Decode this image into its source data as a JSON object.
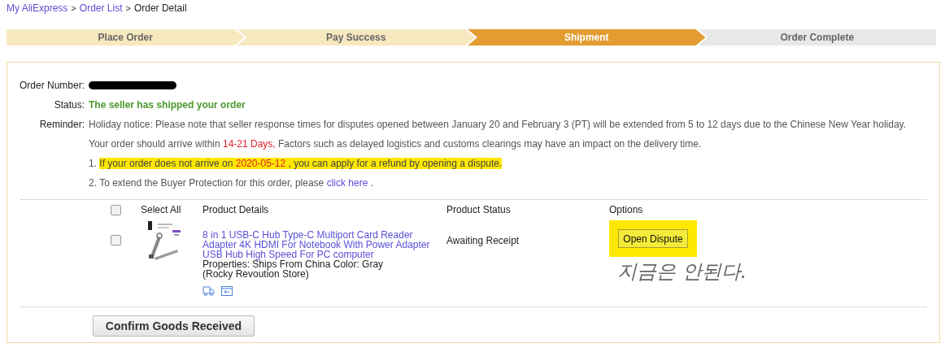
{
  "breadcrumb": [
    {
      "label": "My AliExpress",
      "kind": "link"
    },
    {
      "label": "Order List",
      "kind": "link"
    },
    {
      "label": "Order Detail",
      "kind": "current"
    }
  ],
  "breadcrumb_separator": ">",
  "steps": [
    {
      "label": "Place Order",
      "completed": true,
      "selected": false
    },
    {
      "label": "Pay Success",
      "completed": true,
      "selected": false
    },
    {
      "label": "Shipment",
      "completed": false,
      "selected": true
    },
    {
      "label": "Order Complete",
      "completed": false,
      "selected": false
    }
  ],
  "order": {
    "number_label": "Order Number:",
    "number_redacted": true,
    "status_label": "Status:",
    "status": "The seller has shipped your order",
    "reminder_label": "Reminder:",
    "reminders": [
      {
        "kind": "plain",
        "text": "Holiday notice: Please note that seller response times for disputes opened between January 20 and February 3 (PT) will be extended from 5 to 12 days due to the Chinese New Year holiday."
      },
      {
        "kind": "arrival",
        "before": "Your order should arrive within",
        "days": "14-21 Days,",
        "after": "Factors such as delayed logistics and customs clearings may have an impact on the delivery time."
      },
      {
        "kind": "refund",
        "number": "1.",
        "before": "If your order does not arrive on",
        "date": "2020-05-12",
        "after": ", you can apply for a refund by opening a dispute.",
        "highlighted": true
      },
      {
        "kind": "protection",
        "number": "2.",
        "before": "To extend the Buyer Protection for this order, please",
        "link": "click here",
        "after": "."
      }
    ]
  },
  "table": {
    "select_all": {
      "label": "Select All",
      "checked": false
    },
    "columns": [
      "Product Details",
      "Product Status",
      "Options"
    ],
    "rows": [
      {
        "checked": false,
        "title": "8 in 1 USB-C Hub Type-C Multiport Card Reader Adapter 4K HDMI For Notebook With Power Adapter USB Hub High Speed For PC computer",
        "properties": "Properties: Ships From China Color: Gray",
        "store": "(Rocky Revoution Store)",
        "status": "Awaiting Receipt",
        "option": "Open Dispute",
        "option_highlighted": true
      }
    ]
  },
  "handwritten_note": "지금은 안된다.",
  "confirm_button": "Confirm Goods Received"
}
